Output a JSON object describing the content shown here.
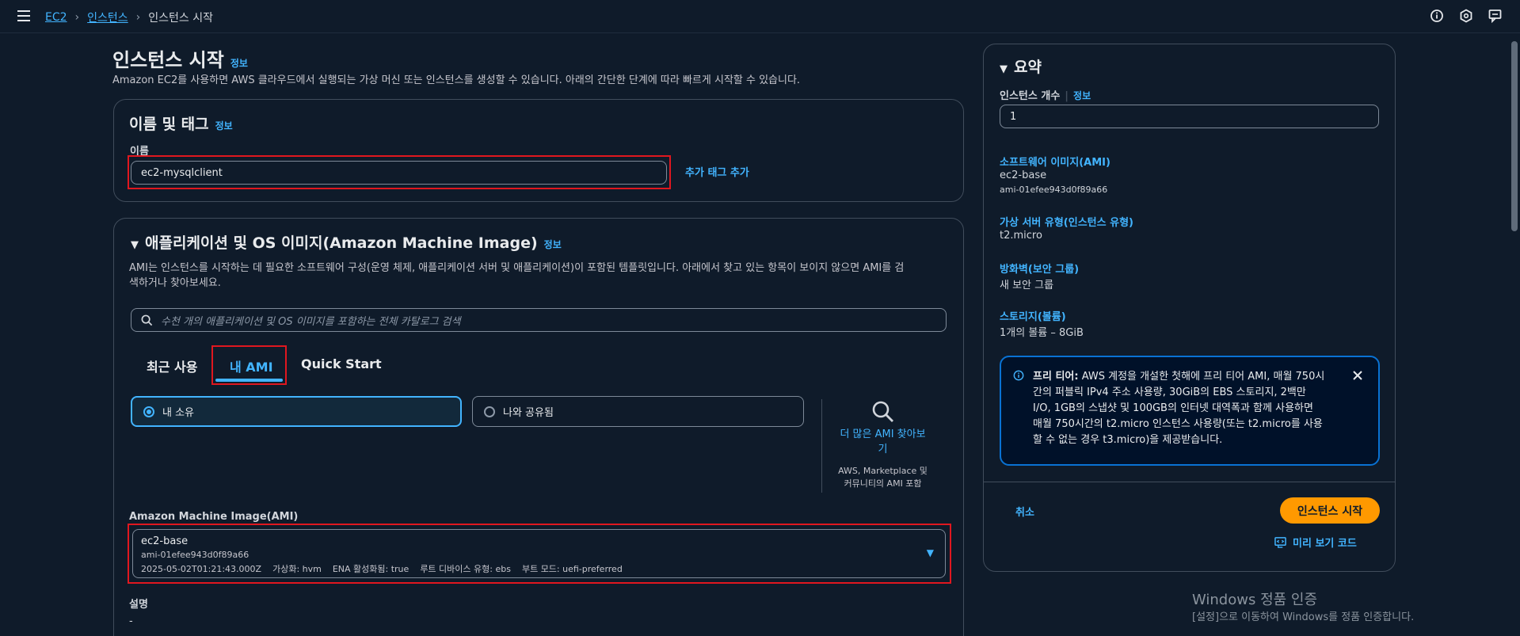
{
  "breadcrumb": {
    "root": "EC2",
    "mid": "인스턴스",
    "current": "인스턴스 시작"
  },
  "page": {
    "title": "인스턴스 시작",
    "info": "정보",
    "subtitle": "Amazon EC2를 사용하면 AWS 클라우드에서 실행되는 가상 머신 또는 인스턴스를 생성할 수 있습니다. 아래의 간단한 단계에 따라 빠르게 시작할 수 있습니다."
  },
  "name_tags": {
    "title": "이름 및 태그",
    "info": "정보",
    "name_label": "이름",
    "name_value": "ec2-mysqlclient",
    "add_tag": "추가 태그 추가"
  },
  "ami_section": {
    "title": "애플리케이션 및 OS 이미지(Amazon Machine Image)",
    "info": "정보",
    "description_line1": "AMI는 인스턴스를 시작하는 데 필요한 소프트웨어 구성(운영 체제, 애플리케이션 서버 및 애플리케이션)이 포함된 템플릿입니다. 아래에서 찾고 있는 항목이 보이지 않으면 AMI를 검",
    "description_line2": "색하거나 찾아보세요.",
    "search_placeholder": "수천 개의 애플리케이션 및 OS 이미지를 포함하는 전체 카탈로그 검색",
    "tabs": [
      "최근 사용",
      "내 AMI",
      "Quick Start"
    ],
    "owned_by_me": "내 소유",
    "shared_with_me": "나와 공유됨",
    "browse_more_line1": "더 많은 AMI 찾아보",
    "browse_more_line2": "기",
    "browse_sub_line1": "AWS, Marketplace 및",
    "browse_sub_line2": "커뮤니티의 AMI 포함",
    "ami_label": "Amazon Machine Image(AMI)",
    "selected_name": "ec2-base",
    "selected_id": "ami-01efee943d0f89a66",
    "selected_date": "2025-05-02T01:21:43.000Z",
    "selected_virt": "가상화: hvm",
    "selected_ena": "ENA 활성화됨: true",
    "selected_root": "루트 디바이스 유형: ebs",
    "selected_boot": "부트 모드: uefi-preferred",
    "desc_label": "설명",
    "desc_value": "-"
  },
  "summary": {
    "title": "요약",
    "count_label": "인스턴스 개수",
    "info": "정보",
    "count_value": "1",
    "ami_head": "소프트웨어 이미지(AMI)",
    "ami_name": "ec2-base",
    "ami_id": "ami-01efee943d0f89a66",
    "type_head": "가상 서버 유형(인스턴스 유형)",
    "type_value": "t2.micro",
    "fw_head": "방화벽(보안 그룹)",
    "fw_value": "새 보안 그룹",
    "storage_head": "스토리지(볼륨)",
    "storage_value": "1개의 볼륨 – 8GiB",
    "free_tier_bold": "프리 티어:",
    "free_tier_lines": [
      " AWS 계정을 개설한 첫해에 프리 티어 AMI, 매월 750시",
      "간의 퍼블릭 IPv4 주소 사용량, 30GiB의 EBS 스토리지, 2백만",
      "I/O, 1GB의 스냅샷 및 100GB의 인터넷 대역폭과 함께 사용하면",
      "매월 750시간의 t2.micro 인스턴스 사용량(또는 t2.micro를 사용",
      "할 수 없는 경우 t3.micro)을 제공받습니다."
    ],
    "cancel": "취소",
    "launch": "인스턴스 시작",
    "preview": "미리 보기 코드"
  },
  "watermark": {
    "title": "Windows 정품 인증",
    "sub": "[설정]으로 이동하여 Windows를 정품 인증합니다."
  },
  "colors": {
    "accent": "#42b4ff",
    "primary": "#ff9900",
    "highlight": "#e0171f",
    "bg": "#0f1b2a"
  }
}
